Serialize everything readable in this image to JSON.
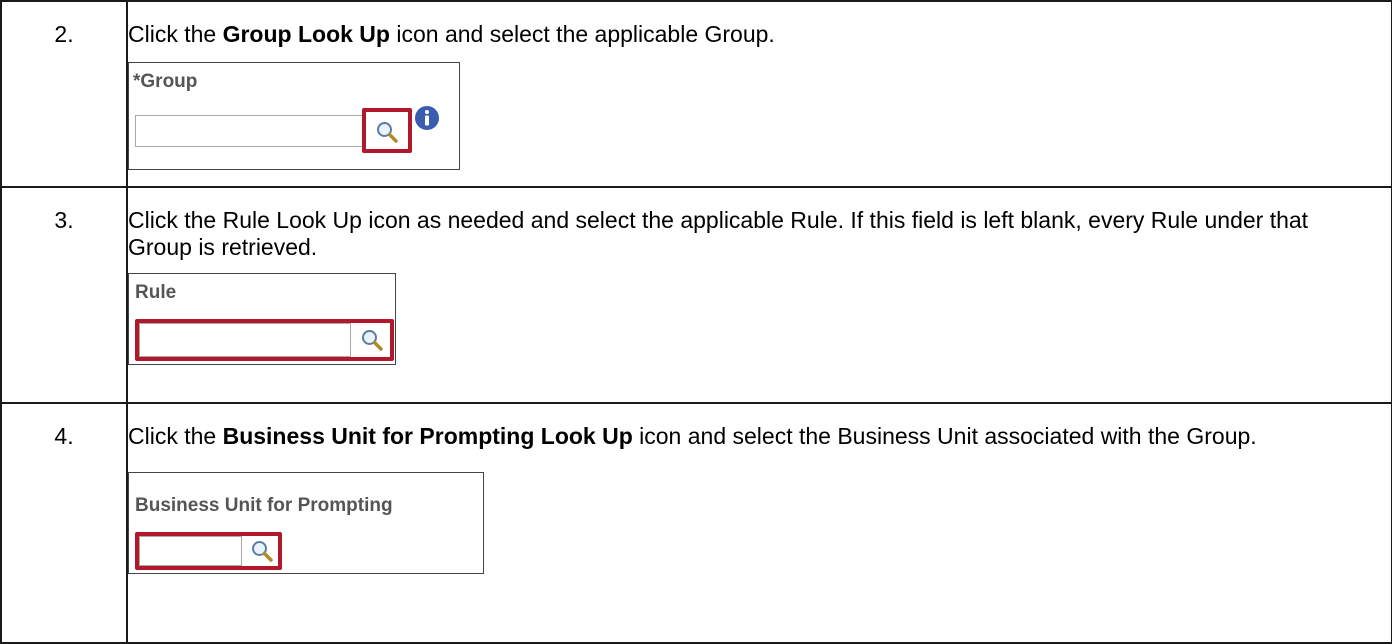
{
  "steps": [
    {
      "number": "2.",
      "pre": "Click the ",
      "bold": "Group Look Up",
      "post": " icon and select the applicable Group.",
      "field_label": "*Group"
    },
    {
      "number": "3.",
      "text": "Click the Rule Look Up icon as needed and select the applicable Rule.  If this field is left blank, every Rule under that Group is retrieved.",
      "field_label": "Rule"
    },
    {
      "number": "4.",
      "pre": "Click the ",
      "bold": "Business Unit for Prompting Look Up",
      "post": " icon and select the Business Unit associated with the Group.",
      "field_label": "Business Unit for Prompting"
    }
  ],
  "colors": {
    "highlight": "#b2182b",
    "info": "#3b5db0",
    "label": "#555555"
  },
  "icons": {
    "lookup": "magnifier-icon",
    "info": "info-icon"
  }
}
